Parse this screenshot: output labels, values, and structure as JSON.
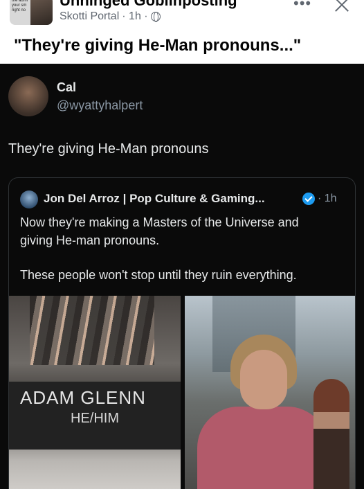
{
  "header": {
    "group_name": "Unhinged Goblinposting",
    "group_avatar_text": "the admi your sm right no",
    "poster": "Skotti Portal",
    "time": "· 1h ·",
    "more": "•••",
    "caption": "\"They're giving He-Man pronouns...\""
  },
  "tweet": {
    "name": "Cal",
    "handle": "@wyattyhalpert",
    "text": "They're giving He-Man pronouns",
    "quote": {
      "name": "Jon Del Arroz | Pop Culture & Gaming...",
      "time": "· 1h",
      "line1": "Now they're making a Masters of the Universe and",
      "line2": "giving He-man pronouns.",
      "line3": "These people won't stop until they ruin everything.",
      "image_left": {
        "plaque_name": "ADAM GLENN",
        "plaque_pronouns": "HE/HIM"
      }
    }
  },
  "colors": {
    "tweet_bg": "#0a0a0a",
    "verified": "#1d9bf0",
    "text_dark": "#e7e9ea",
    "muted": "#8b98a5"
  }
}
